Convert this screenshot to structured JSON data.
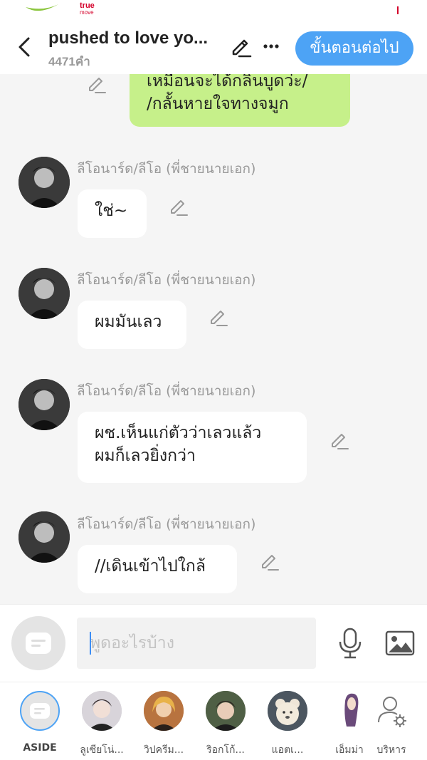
{
  "status": {
    "carrier_top": "true",
    "carrier_bottom": "move"
  },
  "header": {
    "title": "pushed to love yo...",
    "word_count": "4471คำ",
    "next_label": "ขั้นตอนต่อไป"
  },
  "chat": {
    "mine_line1": "เหมือนจะได้กลิ่นบูดว่ะ/",
    "mine_line2": "/กลั้นหายใจทางจมูก",
    "messages": [
      {
        "speaker": "ลีโอนาร์ด/ลีโอ (พี่ชายนายเอก)",
        "text": "ใช่~"
      },
      {
        "speaker": "ลีโอนาร์ด/ลีโอ (พี่ชายนายเอก)",
        "text": "ผมมันเลว"
      },
      {
        "speaker": "ลีโอนาร์ด/ลีโอ (พี่ชายนายเอก)",
        "text_line1": "ผช.เห็นแก่ตัวว่าเลวแล้ว",
        "text_line2": "ผมก็เลวยิ่งกว่า"
      },
      {
        "speaker": "ลีโอนาร์ด/ลีโอ (พี่ชายนายเอก)",
        "text": "//เดินเข้าไปใกล้"
      }
    ]
  },
  "input": {
    "placeholder": "พูดอะไรบ้าง",
    "value": ""
  },
  "characters": [
    {
      "label": "ASIDE"
    },
    {
      "label": "ลูเซียโน่..."
    },
    {
      "label": "วิปครีม..."
    },
    {
      "label": "ริอกโก้..."
    },
    {
      "label": "แอตเ..."
    },
    {
      "label": "เอ็มม่า"
    },
    {
      "label": "บริหาร"
    }
  ],
  "colors": {
    "accent": "#4da3f5",
    "my_bubble": "#c6f08a",
    "brand": "#d4002a"
  },
  "icons": [
    "back-arrow-icon",
    "pencil-icon",
    "more-icon",
    "chat-bubble-icon",
    "microphone-icon",
    "image-icon",
    "manage-user-icon"
  ]
}
